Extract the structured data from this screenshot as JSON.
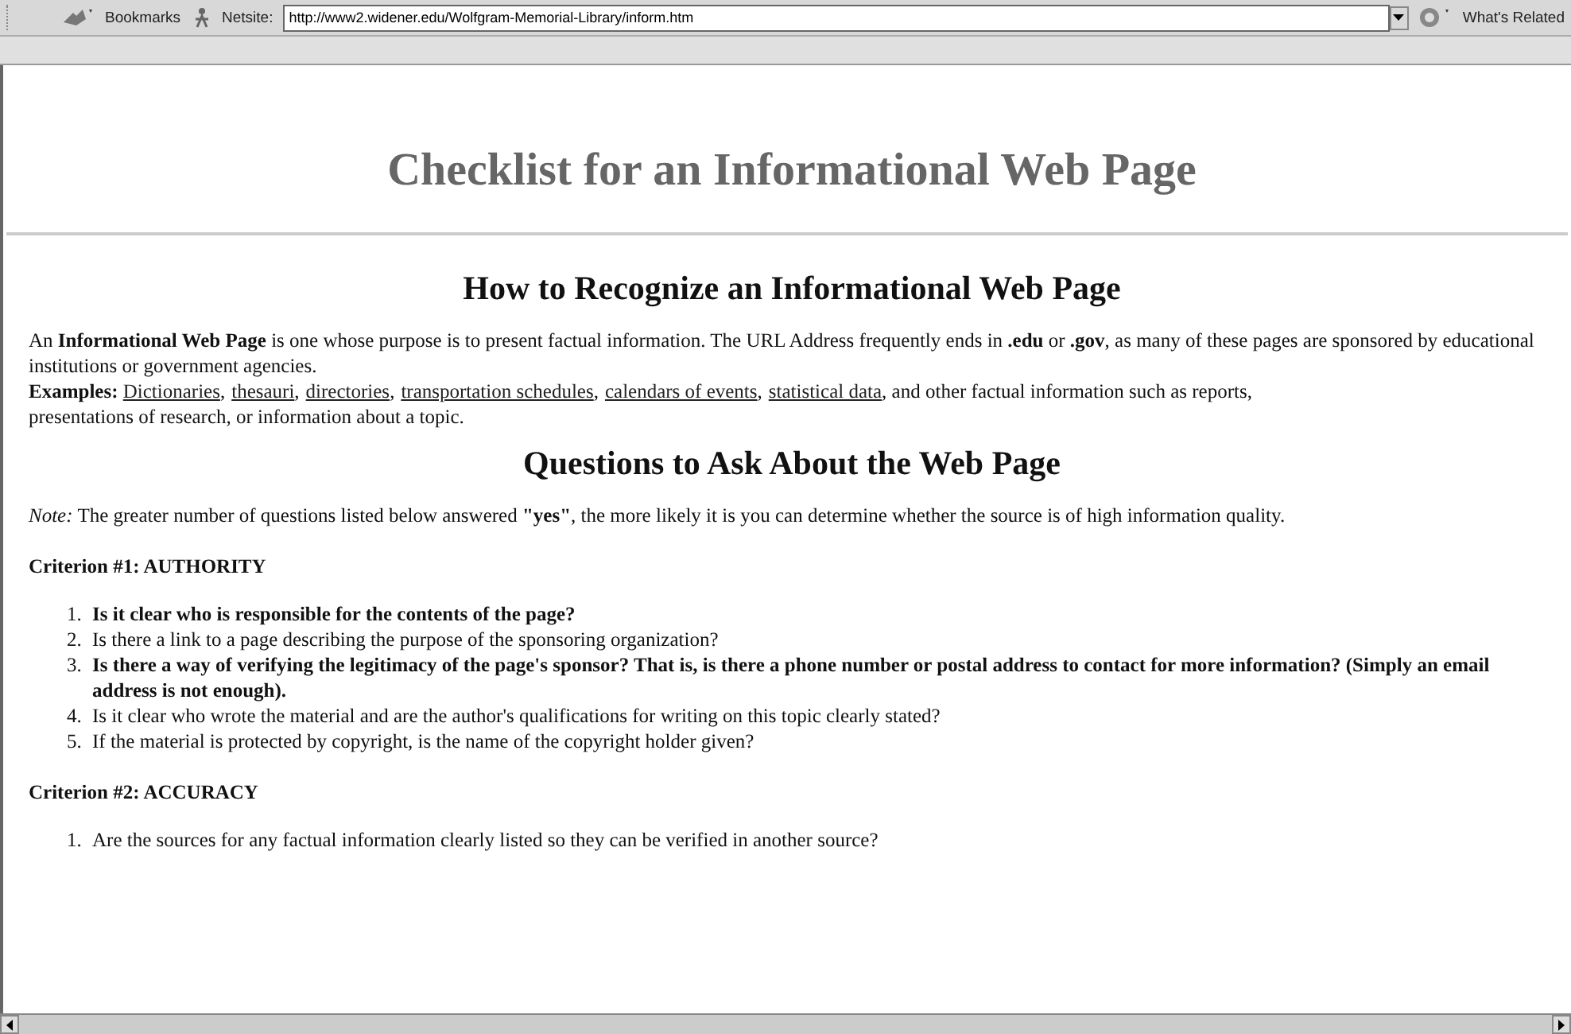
{
  "toolbar": {
    "bookmarks": "Bookmarks",
    "netsite_label": "Netsite:",
    "url": "http://www2.widener.edu/Wolfgram-Memorial-Library/inform.htm",
    "related": "What's Related"
  },
  "page": {
    "title": "Checklist for an Informational Web Page",
    "section_1": {
      "heading": "How to Recognize an Informational Web Page",
      "intro": "An **Informational Web Page** is one whose purpose is to present factual information. The URL Address frequently ends in **.edu** or **.gov**, as many of these pages are sponsored by educational institutions or government agencies.",
      "examples_label": "Examples:",
      "examples": [
        {
          "text": "Dictionaries",
          "sep": ","
        },
        {
          "text": "thesauri",
          "sep": ","
        },
        {
          "text": "directories",
          "sep": ","
        },
        {
          "text": "transportation schedules",
          "sep": ","
        },
        {
          "text": "calendars of events",
          "sep": ","
        },
        {
          "text": "statistical data"
        }
      ],
      "examples_tail": [
        ", and other factual information such as reports,",
        "presentations of research, or information about a topic."
      ]
    },
    "section_2": {
      "heading": "Questions to Ask About the Web Page",
      "note_label": "Note:",
      "note": "The greater number of questions listed below answered **\"yes\"**, the more likely it is you can determine whether the source is of high information quality.",
      "criteria": [
        {
          "title": "Criterion #1: AUTHORITY",
          "questions": [
            {
              "number": "1.",
              "text": "Is it clear who is responsible for the contents of the page?",
              "bold": true
            },
            {
              "number": "2.",
              "text": "Is there a link to a page describing the purpose of the sponsoring organization?",
              "bold": false
            },
            {
              "number": "3.",
              "text": "Is there a way of verifying the legitimacy of the page's sponsor? That is, is there a phone number or postal address to contact for more information? (Simply an email address is not enough).",
              "bold": true
            },
            {
              "number": "4.",
              "text": "Is it clear who wrote the material and are the author's qualifications for writing on this topic clearly stated?",
              "bold": false
            },
            {
              "number": "5.",
              "text": "If the material is protected by copyright, is the name of the copyright holder given?",
              "bold": false
            }
          ]
        },
        {
          "title": "Criterion #2: ACCURACY",
          "questions": [
            {
              "number": "1.",
              "text": "Are the sources for any factual information clearly listed so they can be verified in another source?",
              "bold": false
            }
          ]
        }
      ]
    }
  }
}
